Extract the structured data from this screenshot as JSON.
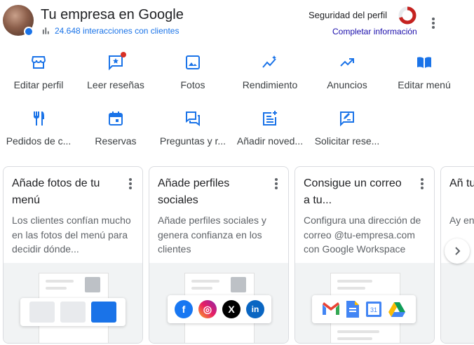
{
  "header": {
    "title": "Tu empresa en Google",
    "interactions": "24.648 interacciones con clientes",
    "security_label": "Seguridad del perfil",
    "security_level": 0.7,
    "complete_info": "Completar información"
  },
  "actions": [
    {
      "label": "Editar perfil",
      "icon": "storefront-icon"
    },
    {
      "label": "Leer reseñas",
      "icon": "review-icon"
    },
    {
      "label": "Fotos",
      "icon": "photo-icon"
    },
    {
      "label": "Rendimiento",
      "icon": "performance-icon"
    },
    {
      "label": "Anuncios",
      "icon": "trending-icon"
    },
    {
      "label": "Editar menú",
      "icon": "menu-book-icon"
    },
    {
      "label": "Pedidos de c...",
      "icon": "restaurant-icon"
    },
    {
      "label": "Reservas",
      "icon": "calendar-icon"
    },
    {
      "label": "Preguntas y r...",
      "icon": "qa-icon"
    },
    {
      "label": "Añadir noved...",
      "icon": "post-add-icon"
    },
    {
      "label": "Solicitar rese...",
      "icon": "rate-review-icon"
    }
  ],
  "cards": [
    {
      "title": "Añade fotos de tu menú",
      "desc": "Los clientes confían mucho en las fotos del menú para decidir dónde..."
    },
    {
      "title": "Añade perfiles sociales",
      "desc": "Añade perfiles sociales y genera confianza en los clientes"
    },
    {
      "title": "Consigue un correo a tu...",
      "desc": "Configura una dirección de correo @tu-empresa.com con Google Workspace"
    },
    {
      "title": "Añ tu",
      "desc": "Ay en"
    }
  ],
  "colors": {
    "accent": "#1a73e8",
    "security_red": "#c5221f"
  }
}
